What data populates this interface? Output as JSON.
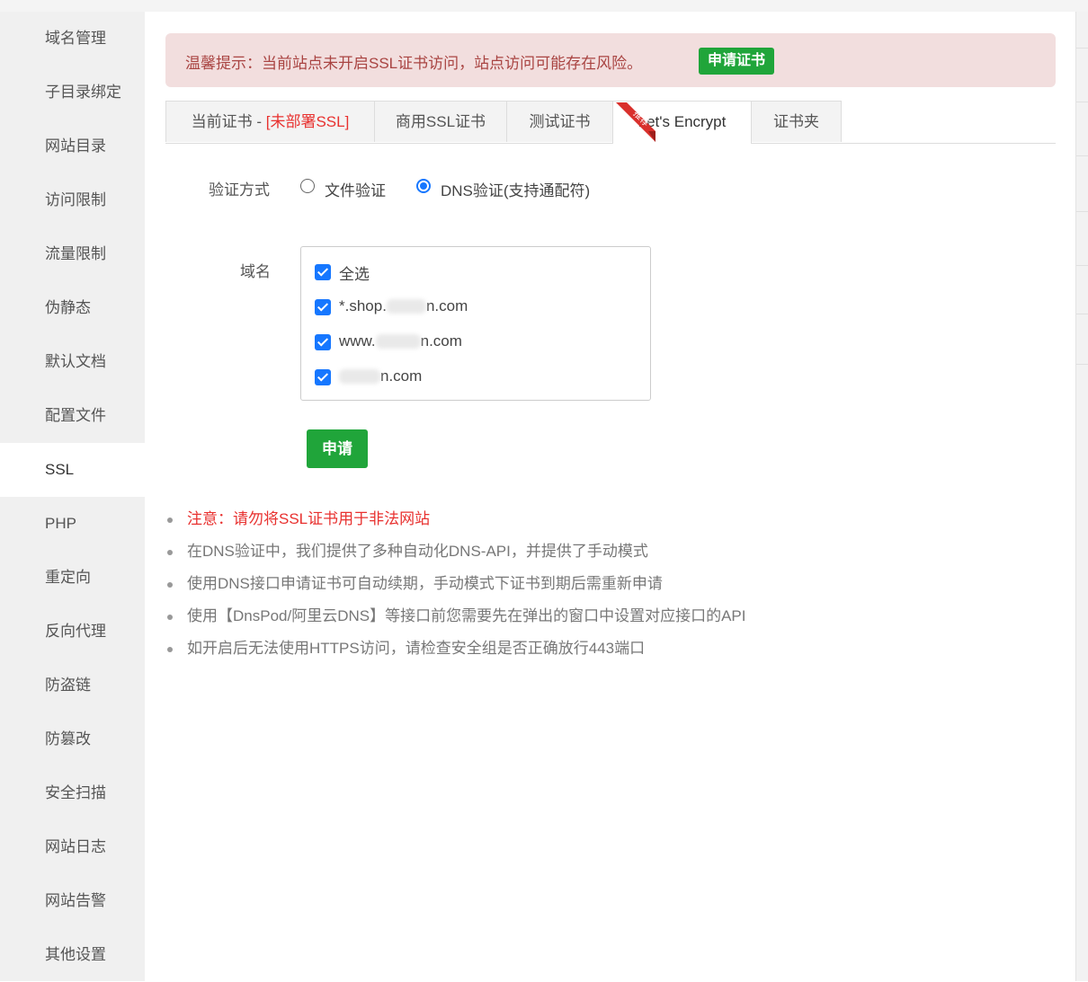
{
  "sidebar": {
    "items": [
      {
        "label": "域名管理"
      },
      {
        "label": "子目录绑定"
      },
      {
        "label": "网站目录"
      },
      {
        "label": "访问限制"
      },
      {
        "label": "流量限制"
      },
      {
        "label": "伪静态"
      },
      {
        "label": "默认文档"
      },
      {
        "label": "配置文件"
      },
      {
        "label": "SSL",
        "active": true
      },
      {
        "label": "PHP"
      },
      {
        "label": "重定向"
      },
      {
        "label": "反向代理"
      },
      {
        "label": "防盗链"
      },
      {
        "label": "防篡改"
      },
      {
        "label": "安全扫描"
      },
      {
        "label": "网站日志"
      },
      {
        "label": "网站告警"
      },
      {
        "label": "其他设置"
      }
    ]
  },
  "alert": {
    "text": "温馨提示：当前站点未开启SSL证书访问，站点访问可能存在风险。",
    "button": "申请证书"
  },
  "tabs": {
    "current_prefix": "当前证书 - ",
    "current_status": "[未部署SSL]",
    "commercial": "商用SSL证书",
    "ribbon": "推荐",
    "test": "测试证书",
    "letsencrypt": "Let's Encrypt",
    "folder": "证书夹",
    "active": "Let's Encrypt"
  },
  "verify": {
    "label": "验证方式",
    "options": [
      {
        "label": "文件验证",
        "checked": false
      },
      {
        "label": "DNS验证(支持通配符)",
        "checked": true
      }
    ]
  },
  "domains": {
    "label": "域名",
    "items": [
      {
        "text": "全选",
        "checked": true
      },
      {
        "text": "*.shop.",
        "suffix": "n.com",
        "checked": true
      },
      {
        "text": "www.",
        "suffix": "n.com",
        "checked": true
      },
      {
        "text": "",
        "suffix": "n.com",
        "checked": true
      }
    ]
  },
  "apply_button": "申请",
  "notes": [
    "注意：请勿将SSL证书用于非法网站",
    "在DNS验证中，我们提供了多种自动化DNS-API，并提供了手动模式",
    "使用DNS接口申请证书可自动续期，手动模式下证书到期后需重新申请",
    "使用【DnsPod/阿里云DNS】等接口前您需要先在弹出的窗口中设置对应接口的API",
    "如开启后无法使用HTTPS访问，请检查安全组是否正确放行443端口"
  ],
  "colors": {
    "green": "#20a53a",
    "danger": "#e8312f",
    "alert_bg": "#f2dede",
    "alert_text": "#a94442",
    "primary": "#1677ff"
  }
}
